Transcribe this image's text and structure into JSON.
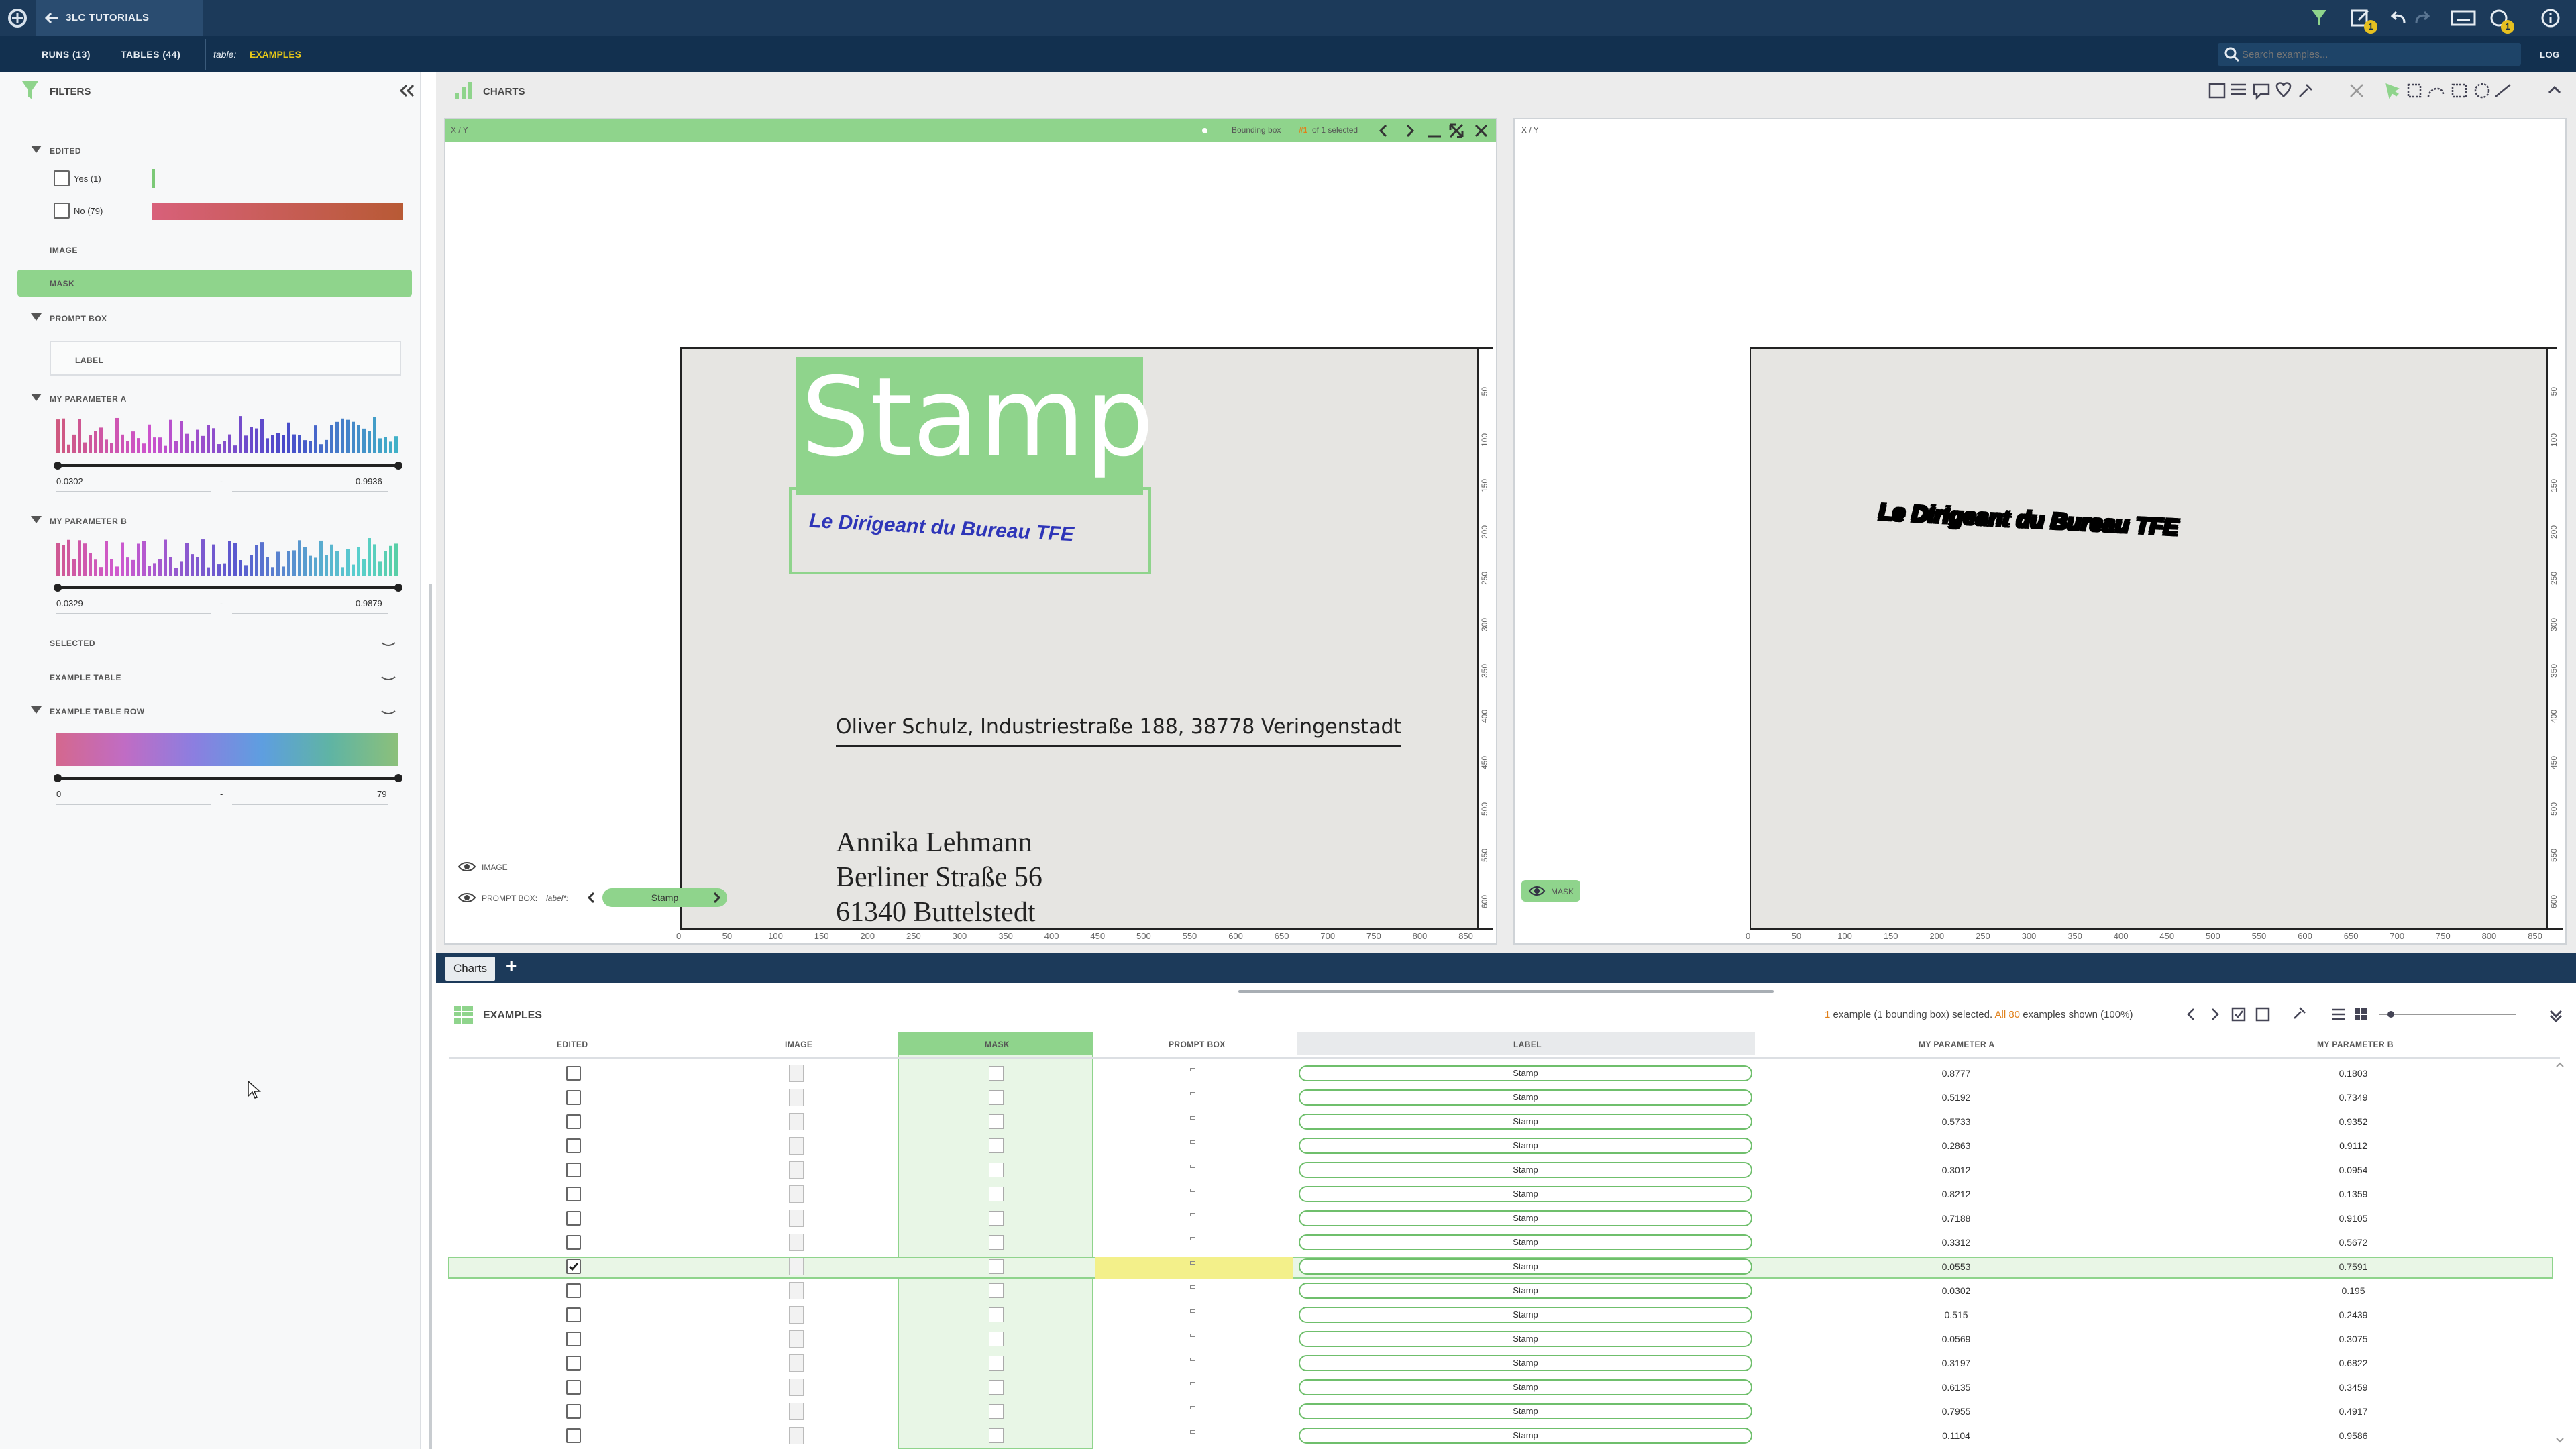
{
  "app": {
    "project": "3LC TUTORIALS",
    "notif_count_1": "1",
    "notif_count_2": "1",
    "log": "LOG"
  },
  "tabs": {
    "runs": "RUNS (13)",
    "tables": "TABLES (44)",
    "table_prefix": "table:",
    "table_name": "EXAMPLES"
  },
  "search": {
    "placeholder": "Search examples..."
  },
  "filters": {
    "title": "FILTERS",
    "edited": {
      "title": "EDITED",
      "yes": "Yes (1)",
      "no": "No (79)",
      "yes_fraction": 0.0125,
      "no_fraction": 0.9875
    },
    "image": "IMAGE",
    "mask": "MASK",
    "prompt_box": {
      "title": "PROMPT BOX",
      "label": "LABEL"
    },
    "param_a": {
      "title": "MY PARAMETER A",
      "min": "0.0302",
      "max": "0.9936"
    },
    "param_b": {
      "title": "MY PARAMETER B",
      "min": "0.0329",
      "max": "0.9879"
    },
    "selected": "SELECTED",
    "example_table": "EXAMPLE TABLE",
    "example_table_row": {
      "title": "EXAMPLE TABLE ROW",
      "min": "0",
      "max": "79"
    },
    "dash": "-"
  },
  "charts": {
    "title": "CHARTS",
    "left": {
      "label": "X / Y",
      "bbox_prefix": "Bounding box ",
      "bbox_index": "#1",
      "bbox_suffix": " of 1 selected",
      "layer_image": "IMAGE",
      "layer_prompt": "PROMPT BOX:",
      "label_field": "label*:",
      "label_value": "Stamp"
    },
    "right": {
      "label": "X / Y",
      "layer_mask": "MASK"
    },
    "x_ticks": [
      "0",
      "50",
      "100",
      "150",
      "200",
      "250",
      "300",
      "350",
      "400",
      "450",
      "500",
      "550",
      "600",
      "650",
      "700",
      "750",
      "800",
      "850"
    ],
    "y_ticks": [
      "50",
      "100",
      "150",
      "200",
      "250",
      "300",
      "350",
      "400",
      "450",
      "500",
      "550",
      "600"
    ],
    "doc": {
      "stamp_box_label": "Stamp",
      "stamp_text": "Le Dirigeant du Bureau TFE",
      "sender": "Oliver Schulz, Industriestraße 188, 38778 Veringenstadt",
      "addr1": "Annika Lehmann",
      "addr2": "Berliner Straße 56",
      "addr3": "61340 Buttelstedt"
    }
  },
  "bottom_tabs": {
    "charts": "Charts",
    "add": "+"
  },
  "examples": {
    "title": "EXAMPLES",
    "status_a": "1",
    "status_b": " example (1 bounding box) selected. ",
    "status_c": "All 80",
    "status_d": " examples shown (100%)",
    "columns": {
      "edited": "EDITED",
      "image": "IMAGE",
      "mask": "MASK",
      "prompt_box": "PROMPT BOX",
      "label": "LABEL",
      "param_a": "MY PARAMETER A",
      "param_b": "MY PARAMETER B"
    },
    "rows": [
      {
        "label": "Stamp",
        "a": "0.8777",
        "b": "0.1803",
        "checked": false
      },
      {
        "label": "Stamp",
        "a": "0.5192",
        "b": "0.7349",
        "checked": false
      },
      {
        "label": "Stamp",
        "a": "0.5733",
        "b": "0.9352",
        "checked": false
      },
      {
        "label": "Stamp",
        "a": "0.2863",
        "b": "0.9112",
        "checked": false
      },
      {
        "label": "Stamp",
        "a": "0.3012",
        "b": "0.0954",
        "checked": false
      },
      {
        "label": "Stamp",
        "a": "0.8212",
        "b": "0.1359",
        "checked": false
      },
      {
        "label": "Stamp",
        "a": "0.7188",
        "b": "0.9105",
        "checked": false
      },
      {
        "label": "Stamp",
        "a": "0.3312",
        "b": "0.5672",
        "checked": false
      },
      {
        "label": "Stamp",
        "a": "0.0553",
        "b": "0.7591",
        "checked": true
      },
      {
        "label": "Stamp",
        "a": "0.0302",
        "b": "0.195",
        "checked": false
      },
      {
        "label": "Stamp",
        "a": "0.515",
        "b": "0.2439",
        "checked": false
      },
      {
        "label": "Stamp",
        "a": "0.0569",
        "b": "0.3075",
        "checked": false
      },
      {
        "label": "Stamp",
        "a": "0.3197",
        "b": "0.6822",
        "checked": false
      },
      {
        "label": "Stamp",
        "a": "0.6135",
        "b": "0.3459",
        "checked": false
      },
      {
        "label": "Stamp",
        "a": "0.7955",
        "b": "0.4917",
        "checked": false
      },
      {
        "label": "Stamp",
        "a": "0.1104",
        "b": "0.9586",
        "checked": false
      }
    ]
  },
  "colors": {
    "topbar": "#1c3a5a",
    "accent_green": "#8fd48c",
    "yellow_highlight": "#f3f08a",
    "orange": "#e0801a",
    "stamp_blue": "#2e35b8"
  },
  "icons": [
    "logo-icon",
    "back-arrow-icon",
    "filter-icon",
    "collapse-left-icon",
    "chart-icon",
    "search-icon",
    "eye-icon",
    "chevron-left-icon",
    "chevron-right-icon",
    "minimize-icon",
    "maximize-icon",
    "close-icon",
    "table-icon",
    "undo-icon",
    "redo-icon",
    "keyboard-icon",
    "info-icon",
    "edit-icon",
    "wrench-icon"
  ]
}
